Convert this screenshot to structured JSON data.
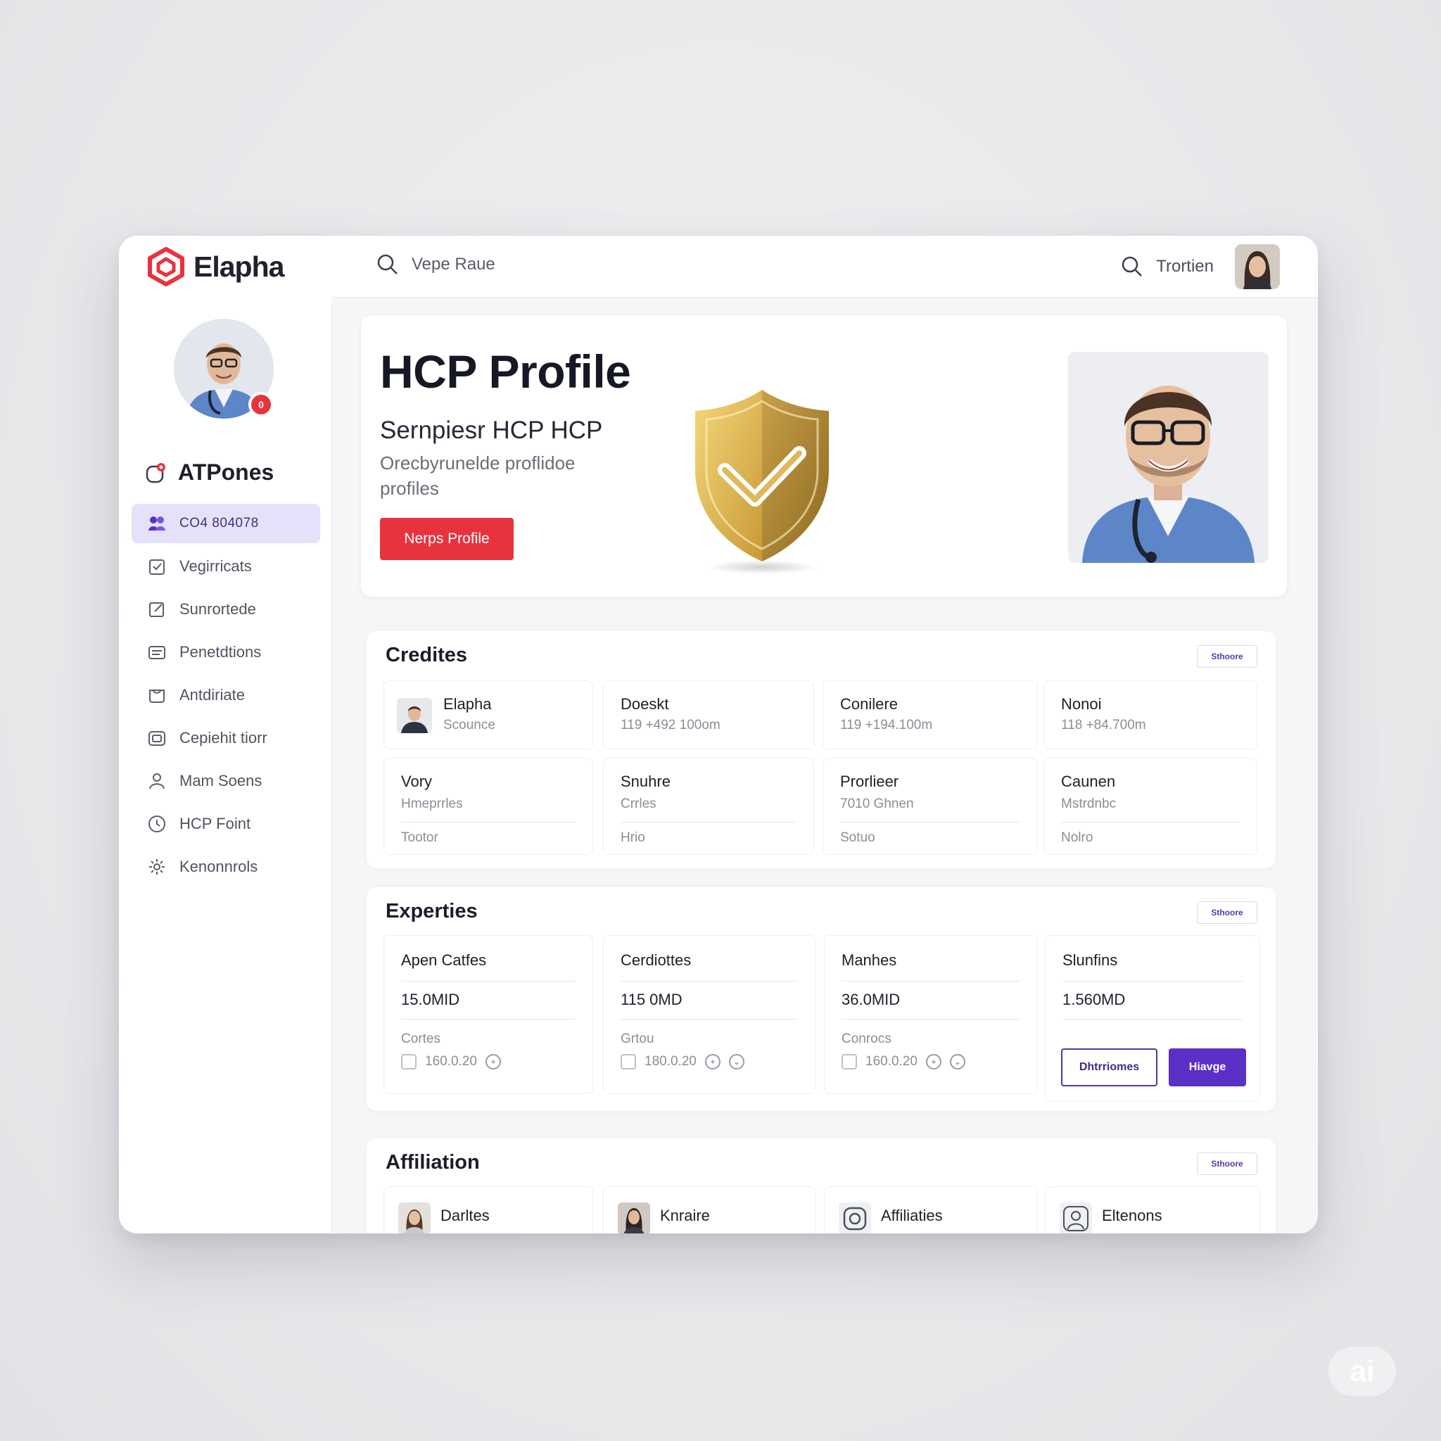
{
  "app": {
    "name": "Elapha"
  },
  "colors": {
    "brand": "#e8333f",
    "accent": "#5a30c6",
    "active_nav_bg": "#e6e1fb",
    "shield_gold": "#d6b14a"
  },
  "topbar": {
    "search_placeholder": "Vepe Raue",
    "right_label": "Trortien"
  },
  "sidebar": {
    "avatar_badge": "0",
    "heading": "ATPones",
    "items": [
      {
        "label": "CO4 804078",
        "icon": "user-group-icon",
        "active": true
      },
      {
        "label": "Vegirricats",
        "icon": "clipboard-icon"
      },
      {
        "label": "Sunrortede",
        "icon": "edit-icon"
      },
      {
        "label": "Penetdtions",
        "icon": "card-icon"
      },
      {
        "label": "Antdiriate",
        "icon": "folder-icon"
      },
      {
        "label": "Cepiehit tiorr",
        "icon": "image-icon"
      },
      {
        "label": "Mam Soens",
        "icon": "person-icon"
      },
      {
        "label": "HCP Foint",
        "icon": "clock-icon"
      },
      {
        "label": "Kenonnrols",
        "icon": "gear-icon"
      }
    ]
  },
  "hero": {
    "title": "HCP Profile",
    "subtitle": "Sernpiesr HCP HCP",
    "description": "Orecbyrunelde proflidoe profiles",
    "cta": "Nerps Profile"
  },
  "credentials": {
    "title": "Credites",
    "see_more": "Sthoore",
    "row1": [
      {
        "title": "Elapha",
        "sub": "Scounce"
      },
      {
        "title": "Doeskt",
        "sub": "119 +492 100om"
      },
      {
        "title": "Conilere",
        "sub": "119 +194.100m"
      },
      {
        "title": "Nonoi",
        "sub": "118 +84.700m"
      }
    ],
    "row2": [
      {
        "title": "Vory",
        "sub": "Hmeprrles",
        "foot": "Tootor"
      },
      {
        "title": "Snuhre",
        "sub": "Crrles",
        "foot": "Hrio"
      },
      {
        "title": "Prorlieer",
        "sub": "7010 Ghnen",
        "foot": "Sotuo"
      },
      {
        "title": "Caunen",
        "sub": "Mstrdnbc",
        "foot": "Nolro"
      }
    ]
  },
  "expertise": {
    "title": "Experties",
    "see_more": "Sthoore",
    "cards": [
      {
        "title": "Apen Catfes",
        "value": "15.0MID",
        "label": "Cortes",
        "num": "160.0.20"
      },
      {
        "title": "Cerdiottes",
        "value": "115 0MD",
        "label": "Grtou",
        "num": "180.0.20"
      },
      {
        "title": "Manhes",
        "value": "36.0MID",
        "label": "Conrocs",
        "num": "160.0.20"
      },
      {
        "title": "Slunfins",
        "value": "1.560MD",
        "btn_outline": "Dhtrriomes",
        "btn_solid": "Hiavge"
      }
    ]
  },
  "affiliation": {
    "title": "Affiliation",
    "see_more": "Sthoore",
    "items": [
      {
        "title": "Darltes",
        "icon": "person-photo-icon"
      },
      {
        "title": "Knraire",
        "icon": "person-photo-icon"
      },
      {
        "title": "Affiliaties",
        "icon": "camera-icon"
      },
      {
        "title": "Eltenons",
        "icon": "person-icon"
      }
    ]
  },
  "watermark": "ai"
}
